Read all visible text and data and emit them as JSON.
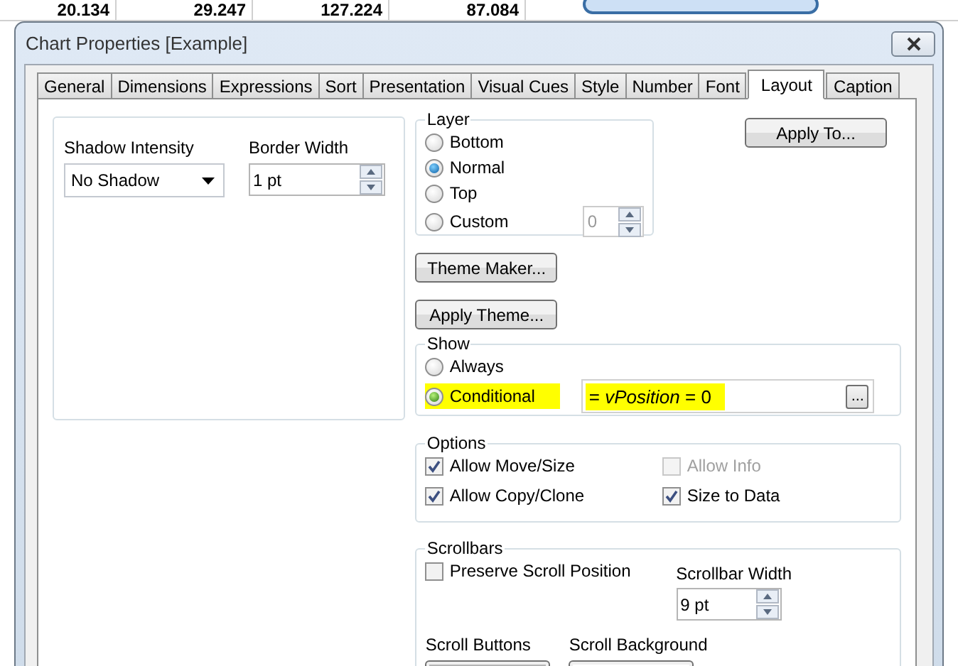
{
  "background_table": {
    "cells": [
      "20.134",
      "29.247",
      "127.224",
      "87.084"
    ]
  },
  "window": {
    "title": "Chart Properties [Example]"
  },
  "tabs": [
    {
      "label": "General",
      "selected": false
    },
    {
      "label": "Dimensions",
      "selected": false
    },
    {
      "label": "Expressions",
      "selected": false
    },
    {
      "label": "Sort",
      "selected": false
    },
    {
      "label": "Presentation",
      "selected": false
    },
    {
      "label": "Visual Cues",
      "selected": false
    },
    {
      "label": "Style",
      "selected": false
    },
    {
      "label": "Number",
      "selected": false
    },
    {
      "label": "Font",
      "selected": false
    },
    {
      "label": "Layout",
      "selected": true
    },
    {
      "label": "Caption",
      "selected": false
    }
  ],
  "shadow_intensity": {
    "label": "Shadow Intensity",
    "value": "No Shadow"
  },
  "border_width": {
    "label": "Border Width",
    "value": "1 pt"
  },
  "layer": {
    "title": "Layer",
    "options": [
      {
        "label": "Bottom",
        "selected": false
      },
      {
        "label": "Normal",
        "selected": true
      },
      {
        "label": "Top",
        "selected": false
      },
      {
        "label": "Custom",
        "selected": false
      }
    ],
    "custom_value": "0",
    "custom_disabled": true
  },
  "apply_to_button": "Apply To...",
  "theme_buttons": [
    "Theme Maker...",
    "Apply Theme..."
  ],
  "show": {
    "title": "Show",
    "options": [
      {
        "label": "Always",
        "selected": false
      },
      {
        "label": "Conditional",
        "selected": true
      }
    ],
    "condition": "= *vPosition* = 0",
    "highlighted": true,
    "browse_button": "..."
  },
  "options": {
    "title": "Options",
    "checkboxes": [
      {
        "label": "Allow Move/Size",
        "checked": true,
        "disabled": false
      },
      {
        "label": "Allow Info",
        "checked": false,
        "disabled": true
      },
      {
        "label": "Allow Copy/Clone",
        "checked": true,
        "disabled": false
      },
      {
        "label": "Size to Data",
        "checked": true,
        "disabled": false
      }
    ]
  },
  "scrollbars": {
    "title": "Scrollbars",
    "preserve": {
      "label": "Preserve Scroll Position",
      "checked": false
    },
    "width_label": "Scrollbar Width",
    "width_value": "9 pt",
    "buttons_label": "Scroll Buttons",
    "background_label": "Scroll Background"
  }
}
